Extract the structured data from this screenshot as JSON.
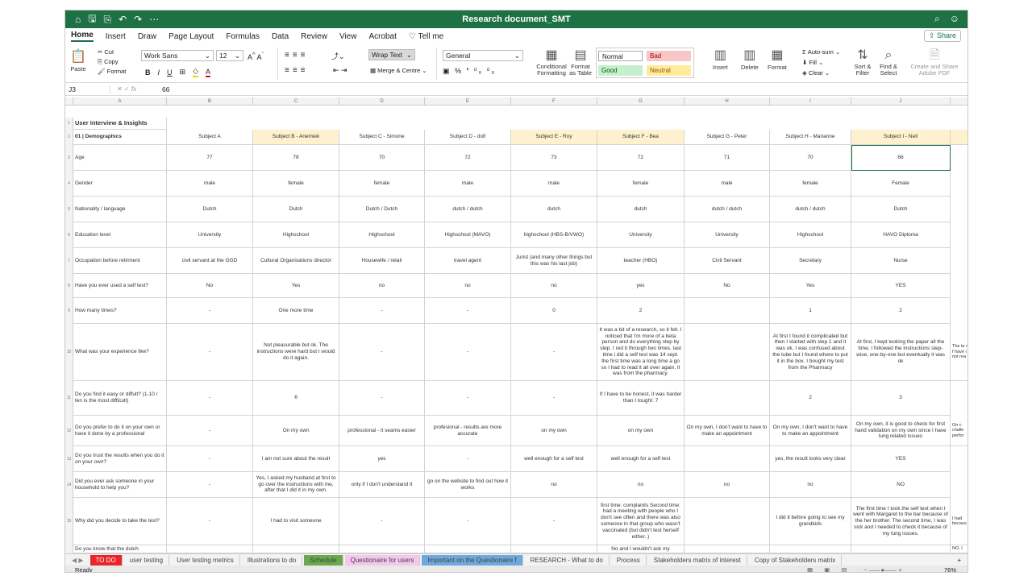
{
  "window": {
    "title": "Research document_SMT"
  },
  "titlebar": {
    "icons": [
      "home-icon",
      "save-icon",
      "save-as-icon",
      "undo-icon",
      "redo-icon",
      "more-icon"
    ],
    "right_icons": [
      "search-icon",
      "person-share-icon"
    ]
  },
  "menu": {
    "tabs": [
      "Home",
      "Insert",
      "Draw",
      "Page Layout",
      "Formulas",
      "Data",
      "Review",
      "View",
      "Acrobat"
    ],
    "tell_me": "Tell me",
    "share": "Share"
  },
  "ribbon": {
    "paste": "Paste",
    "cut": "Cut",
    "copy": "Copy",
    "format": "Format",
    "font": "Work Sans",
    "size": "12",
    "bold": "B",
    "italic": "I",
    "underline": "U",
    "wrap": "Wrap Text",
    "merge": "Merge & Centre",
    "number_format": "General",
    "conditional": "Conditional Formatting",
    "format_table": "Format as Table",
    "styles": {
      "normal": "Normal",
      "bad": "Bad",
      "good": "Good",
      "neutral": "Neutral"
    },
    "insert": "Insert",
    "delete": "Delete",
    "format_cells": "Format",
    "autosum": "Auto-sum",
    "fill": "Fill",
    "clear": "Clear",
    "sort": "Sort & Filter",
    "find": "Find & Select",
    "create_pdf": "Create and Share Adobe PDF"
  },
  "formula_bar": {
    "cell_ref": "J3",
    "fx": "fx",
    "value": "66"
  },
  "columns": [
    "A",
    "B",
    "C",
    "D",
    "E",
    "F",
    "G",
    "H",
    "I",
    "J"
  ],
  "row_numbers": [
    "1",
    "2",
    "3",
    "4",
    "5",
    "6",
    "7",
    "8",
    "9",
    "10",
    "11",
    "12",
    "13",
    "14",
    "15"
  ],
  "sheet": {
    "title": "User Interview & Insights",
    "section": "01 | Demographics",
    "subjects": [
      "Subject A",
      "Subject B - Anemiek",
      "Subject C - Simone",
      "Subject D - dolf",
      "Subject E - Roy",
      "Subject F - Bea",
      "Subject G - Peter",
      "Subject H - Marianne",
      "Subject I - Nell"
    ],
    "rows": [
      {
        "label": "Age",
        "values": [
          "77",
          "78",
          "70",
          "72",
          "73",
          "72",
          "71",
          "70",
          "66"
        ]
      },
      {
        "label": "Gender",
        "values": [
          "male",
          "female",
          "female",
          "male",
          "male",
          "female",
          "male",
          "female",
          "Female"
        ]
      },
      {
        "label": "Nationality / language",
        "values": [
          "Dutch",
          "Dutch",
          "Dutch / Dutch",
          "dutch / dutch",
          "dutch",
          "dutch",
          "dutch / dutch",
          "dutch / dutch",
          "Dutch"
        ]
      },
      {
        "label": "Education level",
        "values": [
          "University",
          "Highschool",
          "Highschool",
          "Highschool (MAVO)",
          "highschool (HBS-B/VWO)",
          "University",
          "University",
          "Highschool",
          "HAVO Diploma"
        ]
      },
      {
        "label": "Occupation before retirment",
        "values": [
          "civil servant at the GGD",
          "Cultural Organisations director",
          "Housewife / retail",
          "travel agent",
          "Jurist (and many other things but this was his last job)",
          "teacher (HBO)",
          "Civil Servant",
          "Secretary",
          "Nurse"
        ]
      },
      {
        "label": "Have you ever used a self test?",
        "values": [
          "No",
          "Yes",
          "no",
          "no",
          "no",
          "yes",
          "No",
          "Yes",
          "YES"
        ]
      },
      {
        "label": "How many times?",
        "values": [
          "-",
          "One more time",
          "-",
          "-",
          "0",
          "2",
          "",
          "1",
          "2"
        ]
      },
      {
        "label": "What was your experience like?",
        "values": [
          "-",
          "Not pleasurable but ok. The instructions were hard but I would do it again.",
          "-",
          "-",
          "-",
          "It was a bit of a research, so it felt. I noticed that I'm more of a beta person and do everything step by step. I red it through two times. last time i did a self test was 14 sept. the first time was a long time a go so I had to read it all over again. It was from the pharmacy.",
          "",
          "At first I found it complicated but then I started with step 1 and it was ok. I was confused about the tube but I found where to put it in the box. I bought my test from the Pharmacy",
          "At first, I kept looking the paper all the time, I followed the instructions step-wise, one-by-one but eventually it was ok"
        ]
      },
      {
        "label": "Do you find it easy or diffult? (1-10 / ten is the most difficult)",
        "values": [
          "-",
          "6",
          "-",
          "-",
          "-",
          "If I have to be honest, it was harder than I tought: 7",
          "",
          "2",
          "3"
        ]
      },
      {
        "label": "Do you prefer to do it on your own or have it done by a professional",
        "values": [
          "-",
          "On my own",
          "professional - it seams easier",
          "profesional - results are more accurate",
          "on my own",
          "on my own",
          "On my own, I don't want to have to make an appointment",
          "On my own, I don't want to have to make an appointment",
          "On my own, it is good to check for first hand validation on my own since I have lung related issues"
        ]
      },
      {
        "label": "Do you trust the results when you do it on your own?",
        "values": [
          "-",
          "I am not sure about the result",
          "yes",
          "-",
          "well enough for a self test",
          "well enough for a self test",
          "",
          "yes, the result looks very clear",
          "YES"
        ]
      },
      {
        "label": "Did you ever ask someone in your household to help you?",
        "values": [
          "-",
          "Yes, I asked my husband at first to go over the instructions with me, after that I did it in my own.",
          "only if I don't understand it",
          "go on the website to find out how it works",
          "no",
          "no",
          "no",
          "no",
          "NO"
        ]
      },
      {
        "label": "Why did you decide to take the test?",
        "values": [
          "-",
          "I had to visit someone",
          "-",
          "-",
          "-",
          "first time: complaints Second time: had a meeting with people who I don't see often and there was also someone in that group who wasn't vaccinated (but didn't test herself either..)",
          "",
          "I did it before going to see my grandkids",
          "The first time I took the self test when I went with Margaret to the bar because of the her brother. The second time, I was sick and I needed to check it because of my lung issues."
        ]
      },
      {
        "label": "Do you know that the dutch",
        "values": [
          "",
          "",
          "",
          "",
          "",
          "No and I wouldn't ask my",
          "",
          "",
          ""
        ]
      }
    ],
    "overflow": {
      "r10": "The te not f have i not rea",
      "r12": "On c challe perfor",
      "r15": "I had becaus",
      "r16": "NO, I"
    }
  },
  "sheet_tabs": [
    "TO DO",
    "user testing",
    "User testing metrics",
    "Illustrations to do",
    "Schedule",
    "Questionaire for users",
    "Important on the Questionaire f",
    "RESEARCH - What to do",
    "Process",
    "Stakeholders matrix of interest",
    "Copy of Stakeholders matrix"
  ],
  "sheet_tab_colors": {
    "TO DO": "#e8262a",
    "Schedule": "#6aa84f",
    "Questionaire for users": "#f5c6ee",
    "Important on the Questionaire f": "#6fa8dc"
  },
  "status": {
    "ready": "Ready",
    "zoom": "76%"
  },
  "colors": {
    "accent": "#1e7145",
    "header_highlight": "#fdf1cf"
  }
}
